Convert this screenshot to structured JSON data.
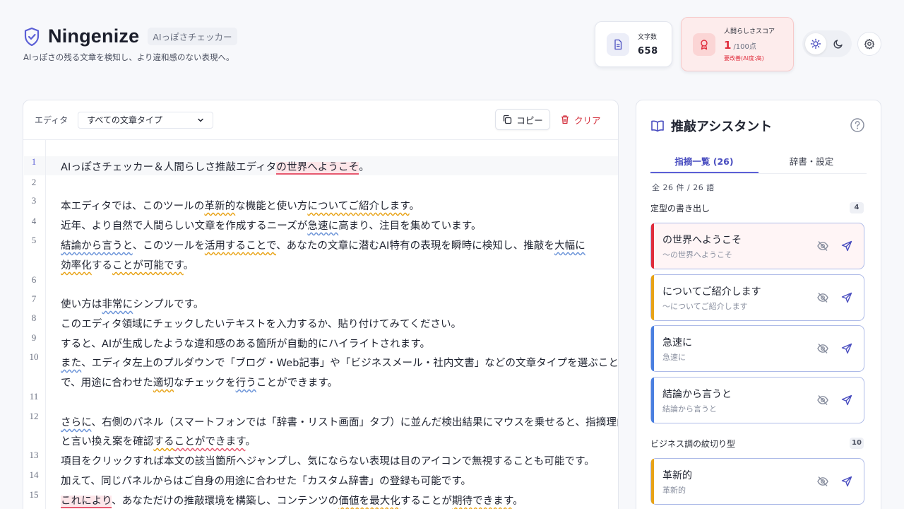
{
  "app": {
    "title": "Ningenize",
    "badge": "AIっぽさチェッカー",
    "tagline": "AIっぽさの残る文章を検知し、より違和感のない表現へ。"
  },
  "stats": {
    "chars_label": "文字数",
    "chars_value": "658",
    "score_label": "人間らしさスコア",
    "score_value": "1",
    "score_unit": "/100点",
    "score_status": "要改善(AI度:高)"
  },
  "editor": {
    "label": "エディタ",
    "doc_type_selected": "すべての文章タイプ",
    "copy_label": "コピー",
    "clear_label": "クリア",
    "line_numbers": [
      "1",
      "2",
      "3",
      "4",
      "5",
      "6",
      "7",
      "8",
      "9",
      "10",
      "11",
      "12",
      "13",
      "14",
      "15"
    ]
  },
  "assistant": {
    "title": "推敲アシスタント",
    "tab_list": "指摘一覧 (26)",
    "tab_dict": "辞書・設定",
    "count_text": "全 26 件 / 26 語",
    "groups": [
      {
        "title": "定型の書き出し",
        "count": "4",
        "items": [
          {
            "title": "の世界へようこそ",
            "sub": "〜の世界へようこそ"
          },
          {
            "title": "についてご紹介します",
            "sub": "〜についてご紹介します"
          },
          {
            "title": "急速に",
            "sub": "急速に"
          },
          {
            "title": "結論から言うと",
            "sub": "結論から言うと"
          }
        ]
      },
      {
        "title": "ビジネス調の紋切り型",
        "count": "10",
        "items": [
          {
            "title": "革新的",
            "sub": "革新的"
          }
        ]
      }
    ]
  },
  "colors": {
    "accent": "#5b5fd6",
    "danger": "#e02c3c",
    "warn": "#e8a317",
    "info": "#6a93d8"
  }
}
